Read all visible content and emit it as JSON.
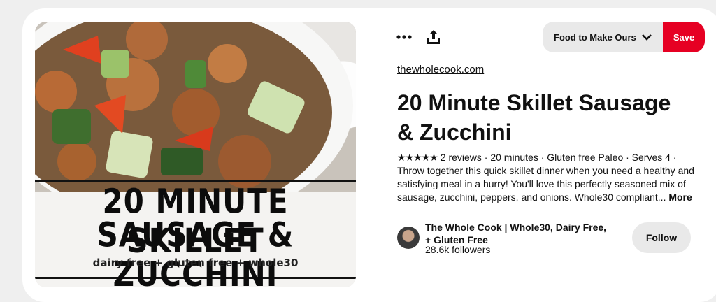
{
  "toolbar": {
    "more_icon": "ellipsis-icon",
    "share_icon": "share-upload-icon",
    "board_selector": "Food to Make Ours...",
    "board_chevron_icon": "chevron-down-icon",
    "save_label": "Save",
    "save_color": "#e60023"
  },
  "pin_image": {
    "overlay_line1": "20 MINUTE SKILLET",
    "overlay_line2": "SAUSAGE & ZUCCHINI",
    "overlay_subtitle": "dairy free + gluten free + whole30"
  },
  "pin": {
    "domain": "thewholecook.com",
    "title": "20 Minute Skillet Sausage & Zucchini",
    "rating_stars": "★★★★★",
    "reviews": "2 reviews",
    "details": " · 20 minutes · Gluten free Paleo · Serves 4 · ",
    "description": "Throw together this quick skillet dinner when you need a healthy and satisfying meal in a hurry! You'll love this perfectly seasoned mix of sausage, zucchini, peppers, and onions. Whole30 compliant...",
    "more_label": "More"
  },
  "creator": {
    "name": "The Whole Cook | Whole30, Dairy Free, + Gluten Free",
    "followers": "28.6k followers",
    "follow_label": "Follow"
  }
}
